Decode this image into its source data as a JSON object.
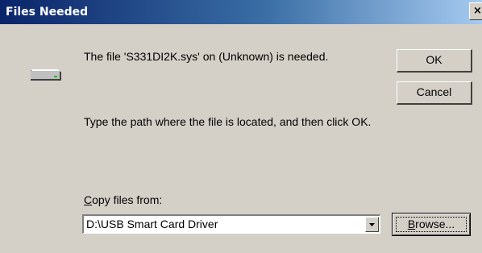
{
  "dialog": {
    "title": "Files Needed",
    "close_glyph": "×",
    "icon": "drive-icon",
    "message_file": "The file 'S331DI2K.sys' on (Unknown) is needed.",
    "message_path": "Type the path where the file is located, and then click OK.",
    "copy_label_access_key": "C",
    "copy_label_rest": "opy files from:",
    "path_value": "D:\\USB Smart Card Driver"
  },
  "buttons": {
    "ok_label": "OK",
    "cancel_label": "Cancel",
    "browse_access_key": "B",
    "browse_rest": "rowse..."
  },
  "colors": {
    "title_gradient_start": "#0a246a",
    "title_gradient_end": "#a6caf0",
    "dialog_face": "#d4d0c8"
  }
}
